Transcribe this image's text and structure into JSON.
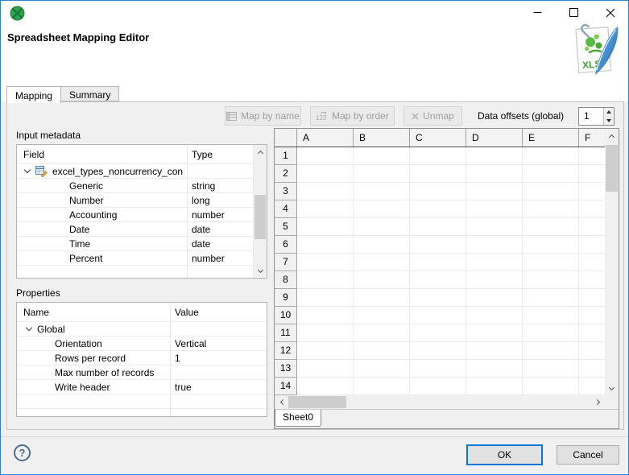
{
  "window": {
    "header_title": "Spreadsheet Mapping Editor",
    "icons": {
      "app_icon": "clover-logo",
      "file_icon": "xls-file"
    }
  },
  "tabs": {
    "mapping": "Mapping",
    "summary": "Summary"
  },
  "toolbar": {
    "map_by_name_label": "Map by name",
    "map_by_order_label": "Map by order",
    "unmap_label": "Unmap",
    "data_offsets_label": "Data offsets (global)",
    "data_offsets_value": "1"
  },
  "input_metadata": {
    "label": "Input metadata",
    "columns": [
      "Field",
      "Type"
    ],
    "root": "excel_types_noncurrency_con",
    "rows": [
      {
        "field": "Generic",
        "type": "string"
      },
      {
        "field": "Number",
        "type": "long"
      },
      {
        "field": "Accounting",
        "type": "number"
      },
      {
        "field": "Date",
        "type": "date"
      },
      {
        "field": "Time",
        "type": "date"
      },
      {
        "field": "Percent",
        "type": "number"
      }
    ]
  },
  "properties_panel": {
    "label": "Properties",
    "columns": [
      "Name",
      "Value"
    ],
    "root": "Global",
    "rows": [
      {
        "name": "Orientation",
        "value": "Vertical"
      },
      {
        "name": "Rows per record",
        "value": "1"
      },
      {
        "name": "Max number of records",
        "value": ""
      },
      {
        "name": "Write header",
        "value": "true"
      }
    ]
  },
  "spreadsheet": {
    "columns": [
      "A",
      "B",
      "C",
      "D",
      "E",
      "F"
    ],
    "rows": [
      "1",
      "2",
      "3",
      "4",
      "5",
      "6",
      "7",
      "8",
      "9",
      "10",
      "11",
      "12",
      "13",
      "14"
    ],
    "sheet_tab": "Sheet0"
  },
  "footer": {
    "help_glyph": "?",
    "ok_label": "OK",
    "cancel_label": "Cancel"
  },
  "colors": {
    "accent": "#0078d7",
    "clover_green": "#2ea44f"
  }
}
